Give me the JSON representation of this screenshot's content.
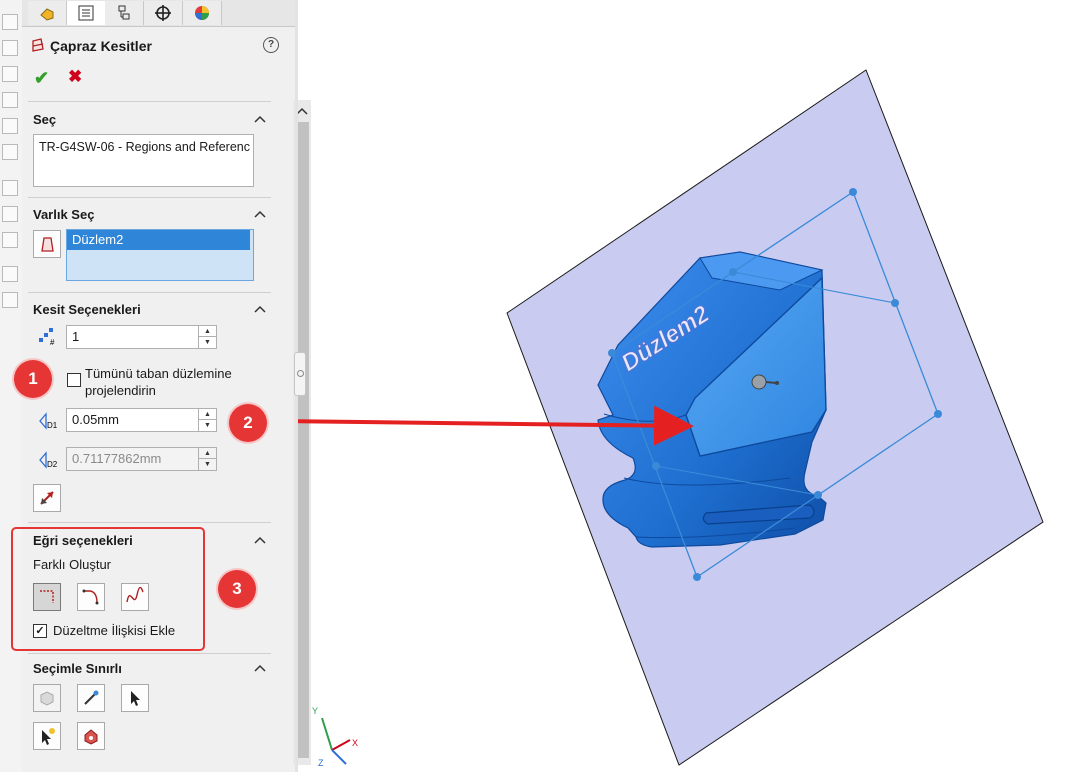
{
  "panel": {
    "title": "Çapraz Kesitler",
    "help_label": "?",
    "tabs": [
      "feature-manager-icon",
      "property-manager-icon",
      "configuration-manager-icon",
      "dimxpert-icon",
      "display-manager-icon"
    ]
  },
  "sections": {
    "select": {
      "title": "Seç",
      "value": "TR-G4SW-06 - Regions and Referenc"
    },
    "entity": {
      "title": "Varlık Seç",
      "selected": "Düzlem2"
    },
    "section_options": {
      "title": "Kesit Seçenekleri",
      "count": "1",
      "project_label": "Tümünü taban düzlemine projelendirin",
      "project_checked": false,
      "d1": "0.05mm",
      "d2": "0.71177862mm"
    },
    "curve_options": {
      "title": "Eğri seçenekleri",
      "create_label": "Farklı Oluştur",
      "fix_label": "Düzeltme İlişkisi Ekle",
      "fix_checked": true
    },
    "selection_limited": {
      "title": "Seçimle Sınırlı"
    }
  },
  "markers": [
    "1",
    "2",
    "3"
  ],
  "viewport": {
    "plane_label": "Düzlem2",
    "axes": [
      "Y",
      "X",
      "Z"
    ]
  },
  "colors": {
    "accent_red": "#e53535",
    "part_blue": "#1e6fd0",
    "plane": "#c9ccf0",
    "ok_green": "#33a02c",
    "selection_blue": "#2f86d8"
  }
}
